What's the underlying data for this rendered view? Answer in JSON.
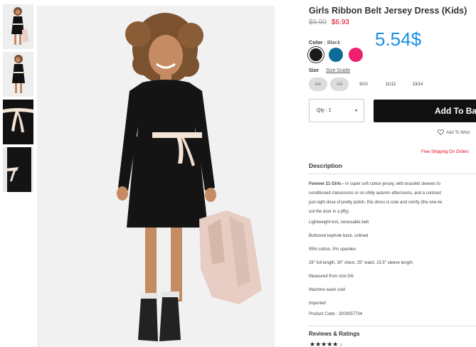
{
  "product": {
    "title": "Girls Ribbon Belt Jersey Dress (Kids)",
    "price_old": "$9.90",
    "price_new": "$6.93",
    "overlay_price": "5.54$"
  },
  "color": {
    "label": "Color",
    "value": ": Black",
    "swatches": [
      "#1a1a1a",
      "#0e6d98",
      "#f01e6e"
    ]
  },
  "size": {
    "label": "Size",
    "guide": "Size Guide",
    "options": [
      "5/6",
      "7/8",
      "9/10",
      "11/12",
      "13/14"
    ]
  },
  "qty": {
    "label": "Qty : 1",
    "arrow": "▼"
  },
  "add_to_bag": "Add To Ba",
  "wishlist": "Add To Wish",
  "free_shipping": "Free Shipping On Orders",
  "description": {
    "heading": "Description",
    "lead_bold": "Forever 21 Girls -",
    "lead_lines": [
      " In super soft cotton jersey, with bracelet sleeves to",
      "conditioned classrooms or on chilly autumn afternoons, and a contrast",
      "just-right dose of pretty polish, this dress is cute and comfy (the one-tw",
      "out the door in a jiffy)."
    ],
    "items": [
      "Lightweight knit, removable belt",
      "Buttoned keyhole back, unlined",
      "95% cotton, 5% spandex",
      "28\" full length, 30\" chest, 25\" waist, 15.5\" sleeve length",
      "Measured from size 5/6",
      "Machine wash cold",
      "Imported",
      "Product Code : 2000057734"
    ]
  },
  "reviews": {
    "heading": "Reviews & Ratings",
    "stars": "★★★★★",
    "count": "2"
  },
  "colors": {
    "accent": "#e0001b",
    "overlay": "#1a8fe3",
    "button": "#111111"
  }
}
